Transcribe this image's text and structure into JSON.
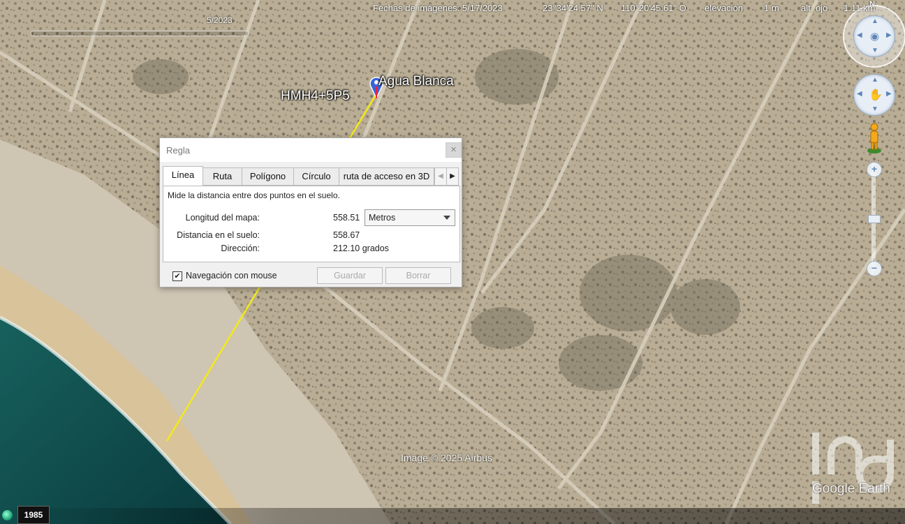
{
  "timeline": {
    "label": "5/2023"
  },
  "placemark": {
    "name": "Agua Blanca",
    "plus_code": "HMH4+5P5"
  },
  "ruler": {
    "title": "Regla",
    "tabs": [
      "Línea",
      "Ruta",
      "Polígono",
      "Círculo",
      "ruta de acceso en 3D"
    ],
    "active_tab": "Línea",
    "description": "Mide la distancia entre dos puntos en el suelo.",
    "map_length_label": "Longitud del mapa:",
    "map_length_value": "558.51",
    "unit_selected": "Metros",
    "ground_distance_label": "Distancia en el suelo:",
    "ground_distance_value": "558.67",
    "heading_label": "Dirección:",
    "heading_value": "212.10 grados",
    "mouse_nav_label": "Navegación con mouse",
    "mouse_nav_checked": "✔",
    "save_label": "Guardar",
    "clear_label": "Borrar"
  },
  "nav": {
    "north": "N",
    "zoom_in": "+",
    "zoom_out": "−",
    "zoom_mid": "−"
  },
  "attribution": "Image © 2025 Airbus",
  "logo": "Google Earth",
  "status": {
    "year": "1985",
    "imagery_date": "Fechas de imágenes: 5/17/2023",
    "lat": "23°34'24.57\" N",
    "lon": "110°20'45.61\" O",
    "elevation_label": "elevación",
    "elevation_value": "1 m",
    "eye_alt_label": "alt. ojo",
    "eye_alt_value": "1.11 km"
  },
  "colors": {
    "measure_line": "#f2ea1a",
    "ocean": "#0f4d4c",
    "sand": "#d9c9a8",
    "desert": "#b7ab92",
    "pin": "#3b64d8"
  },
  "icons": [
    "globe-icon",
    "placemark-pin-icon",
    "close-icon",
    "look-around-icon",
    "pan-hand-icon",
    "street-view-person-icon",
    "zoom-in-icon",
    "zoom-out-icon",
    "dropdown-arrow-icon"
  ]
}
